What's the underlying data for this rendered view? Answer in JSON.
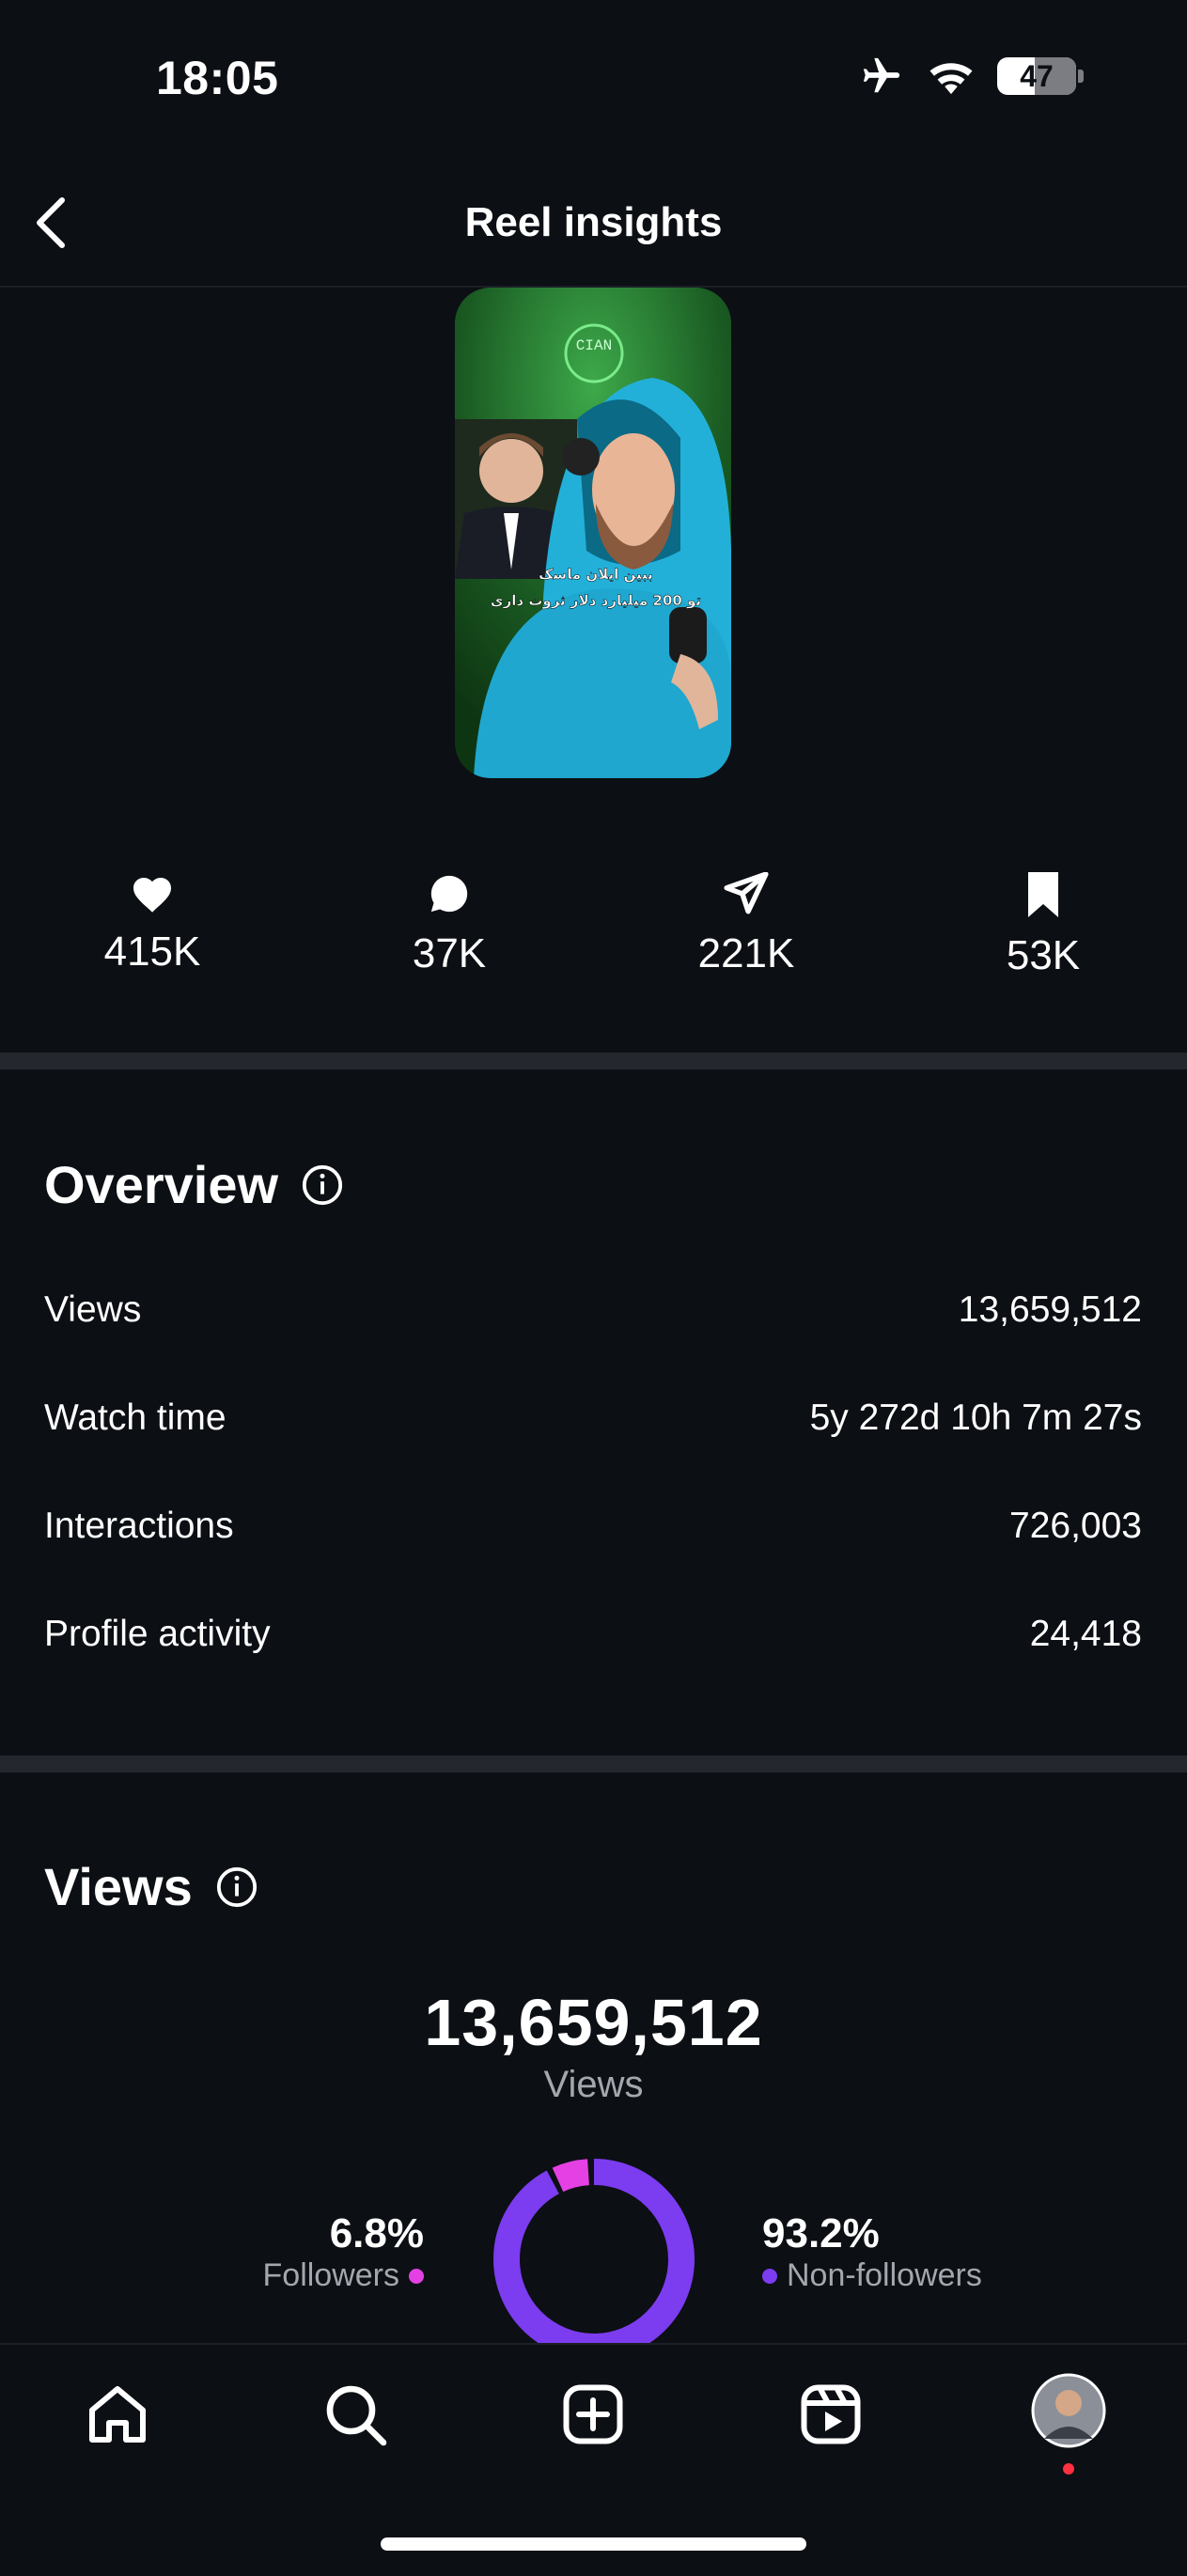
{
  "status_bar": {
    "time": "18:05",
    "battery": "47"
  },
  "header": {
    "title": "Reel insights"
  },
  "reel": {
    "caption_line1": "ببین ایلان ماسک",
    "caption_line2": "تو 200 میلیارد دلار ثروت داری",
    "watermark": "CIAN"
  },
  "stats": [
    {
      "icon": "heart-icon",
      "value": "415K"
    },
    {
      "icon": "comment-icon",
      "value": "37K"
    },
    {
      "icon": "share-icon",
      "value": "221K"
    },
    {
      "icon": "bookmark-icon",
      "value": "53K"
    }
  ],
  "overview": {
    "title": "Overview",
    "rows": [
      {
        "label": "Views",
        "value": "13,659,512"
      },
      {
        "label": "Watch time",
        "value": "5y 272d 10h 7m 27s"
      },
      {
        "label": "Interactions",
        "value": "726,003"
      },
      {
        "label": "Profile activity",
        "value": "24,418"
      }
    ]
  },
  "views": {
    "title": "Views",
    "total": "13,659,512",
    "total_label": "Views",
    "followers": {
      "percent": "6.8%",
      "label": "Followers",
      "fraction": 0.068,
      "color": "#e440e4"
    },
    "non_followers": {
      "percent": "93.2%",
      "label": "Non-followers",
      "fraction": 0.932,
      "color": "#7c3cf0"
    }
  },
  "nav": [
    "home-icon",
    "search-icon",
    "create-icon",
    "reels-icon",
    "profile-avatar"
  ]
}
